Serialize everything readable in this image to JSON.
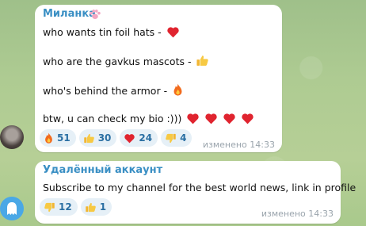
{
  "messages": [
    {
      "sender": "Миланка",
      "lines": [
        "who wants tin foil hats -",
        "who are the gavkus mascots -",
        "who's behind the armor -",
        "btw, u can check my bio :)))"
      ],
      "reactions": [
        {
          "icon": "fire-icon",
          "count": "51"
        },
        {
          "icon": "thumbs-up-icon",
          "count": "30"
        },
        {
          "icon": "heart-icon",
          "count": "24"
        },
        {
          "icon": "thumbs-down-icon",
          "count": "4"
        }
      ],
      "meta": "изменено 14:33"
    },
    {
      "sender": "Удалённый аккаунт",
      "text": "Subscribe to my channel for the best world news, link in profile",
      "reactions": [
        {
          "icon": "thumbs-down-icon",
          "count": "12"
        },
        {
          "icon": "thumbs-up-icon",
          "count": "1"
        }
      ],
      "meta": "изменено 14:33"
    }
  ],
  "colors": {
    "sender": "#3a8fc4",
    "reaction_bg": "#e6f0f7",
    "reaction_text": "#2a6fa3",
    "deleted_avatar": "#4aa8e6"
  }
}
